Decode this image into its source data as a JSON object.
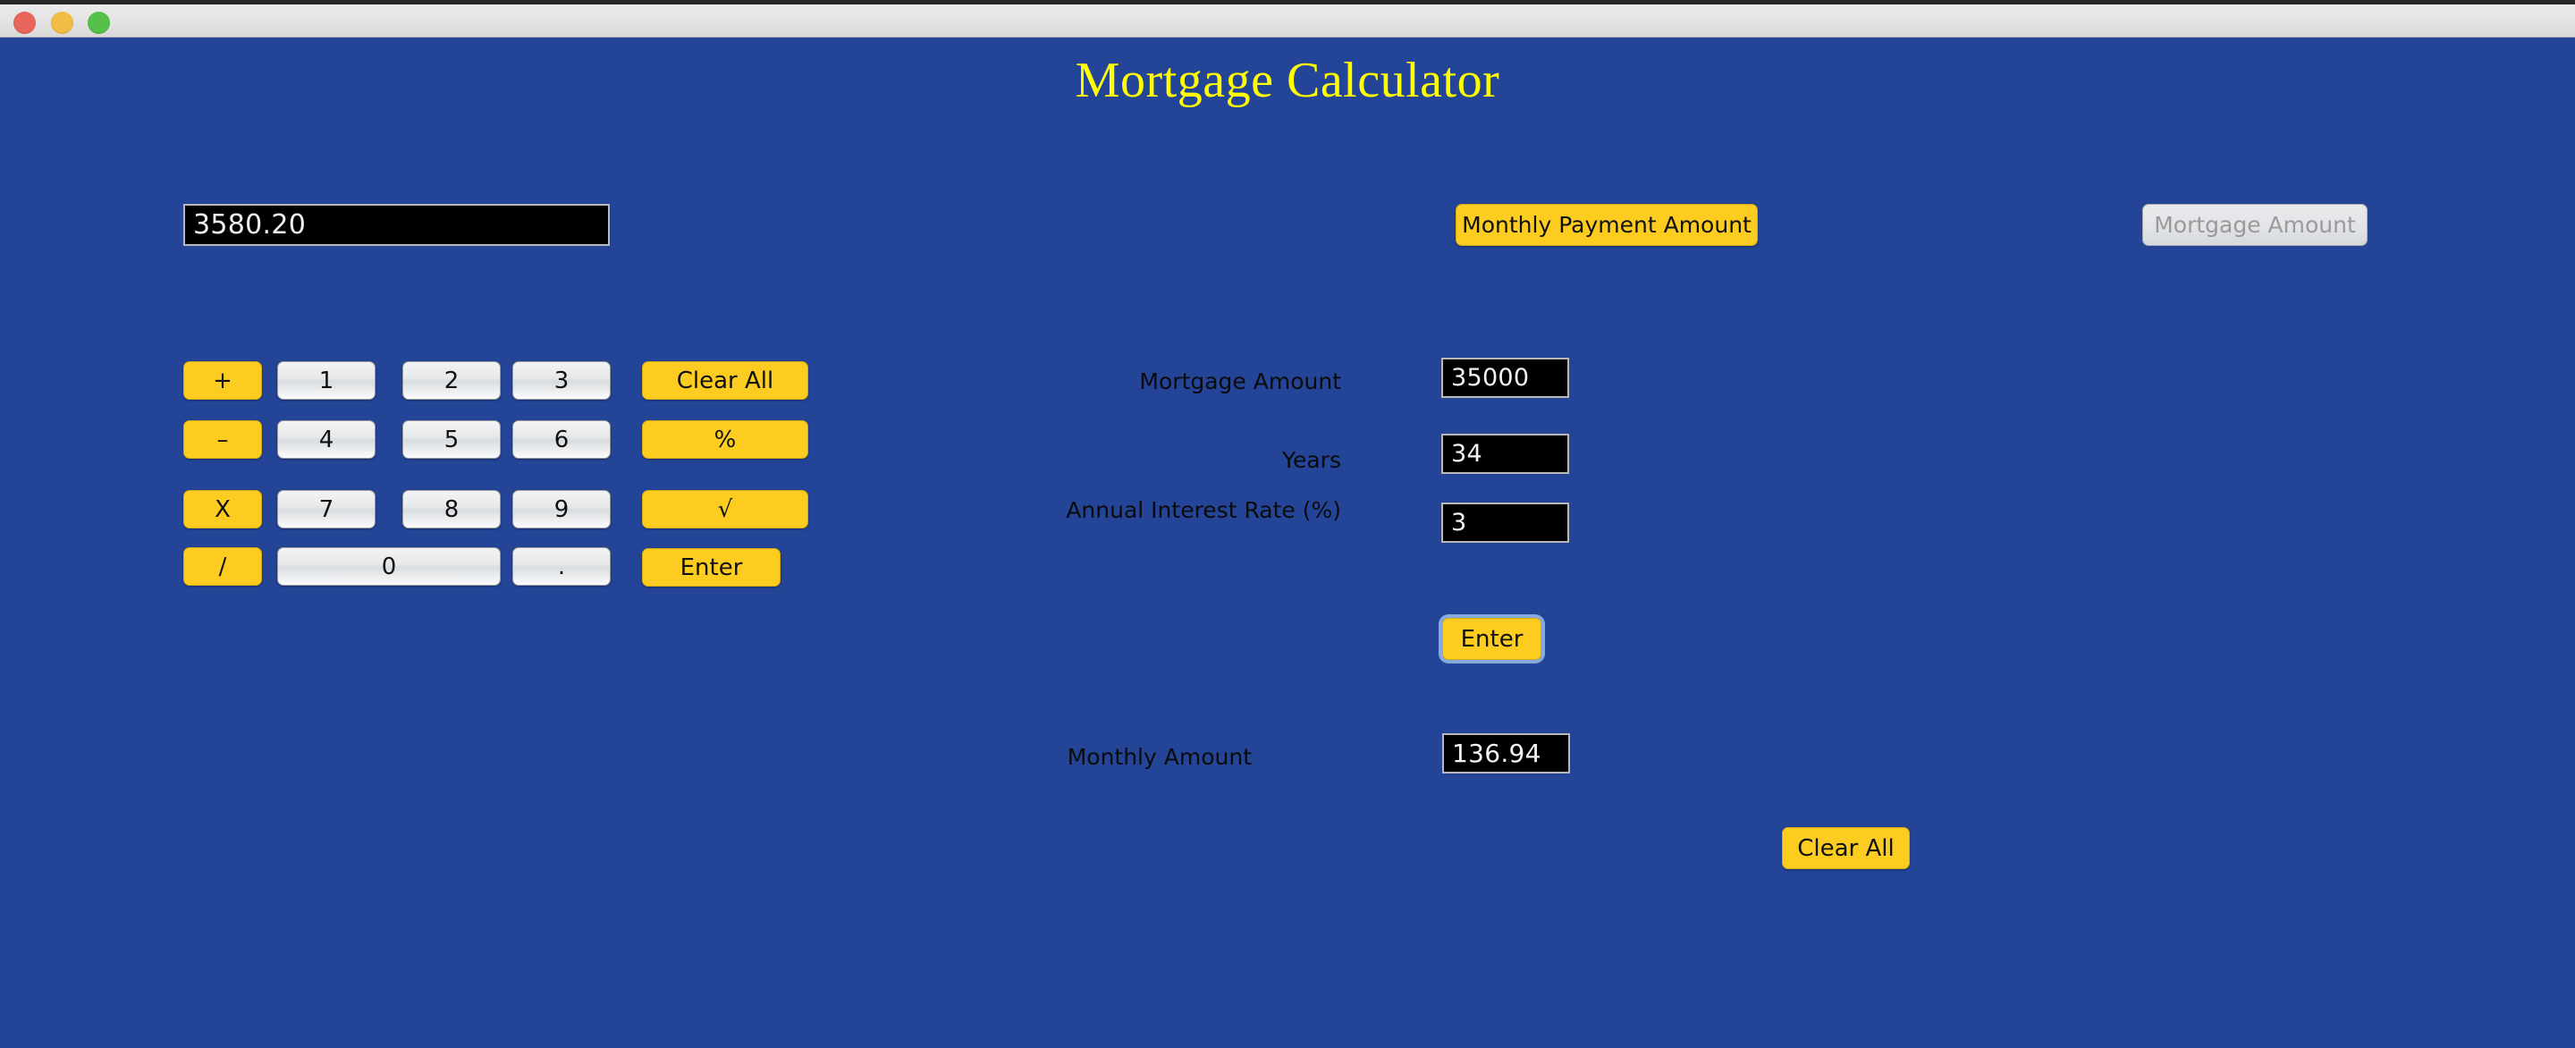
{
  "window": {
    "traffic_lights": [
      "close",
      "minimize",
      "maximize"
    ]
  },
  "app": {
    "title": "Mortgage Calculator",
    "background_color": "#234497",
    "accent_color": "#fccc20",
    "title_color": "#ffff00"
  },
  "calculator": {
    "display_value": "3580.20",
    "keypad": [
      {
        "label": "+",
        "style": "yellow"
      },
      {
        "label": "1",
        "style": "gray"
      },
      {
        "label": "2",
        "style": "gray"
      },
      {
        "label": "3",
        "style": "gray"
      },
      {
        "label": "Clear All",
        "style": "yellow"
      },
      {
        "label": "–",
        "style": "yellow"
      },
      {
        "label": "4",
        "style": "gray"
      },
      {
        "label": "5",
        "style": "gray"
      },
      {
        "label": "6",
        "style": "gray"
      },
      {
        "label": "%",
        "style": "yellow"
      },
      {
        "label": "X",
        "style": "yellow"
      },
      {
        "label": "7",
        "style": "gray"
      },
      {
        "label": "8",
        "style": "gray"
      },
      {
        "label": "9",
        "style": "gray"
      },
      {
        "label": "√",
        "style": "yellow"
      },
      {
        "label": "/",
        "style": "yellow"
      },
      {
        "label": "0",
        "style": "gray"
      },
      {
        "label": ".",
        "style": "gray"
      },
      {
        "label": "Enter",
        "style": "yellow"
      }
    ]
  },
  "modes": {
    "monthly_payment_label": "Monthly Payment Amount",
    "mortgage_amount_label": "Mortgage Amount",
    "active": "Monthly Payment Amount"
  },
  "form": {
    "mortgage_amount": {
      "label": "Mortgage Amount",
      "value": "35000"
    },
    "years": {
      "label": "Years",
      "value": "34"
    },
    "interest_rate": {
      "label": "Annual Interest Rate (%)",
      "value": "3"
    },
    "enter_label": "Enter",
    "result": {
      "label": "Monthly Amount",
      "value": "136.94"
    },
    "clear_all_label": "Clear All"
  }
}
